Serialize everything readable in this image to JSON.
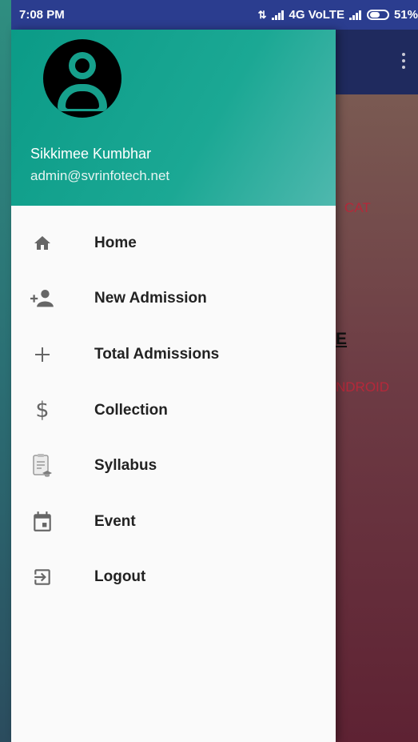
{
  "status_bar": {
    "time": "7:08 PM",
    "network": "4G VoLTE",
    "battery": "51%"
  },
  "background_app": {
    "text_cat": "CAT",
    "text_e": "E",
    "text_android": "NDROID"
  },
  "drawer": {
    "user_name": "Sikkimee Kumbhar",
    "user_email": "admin@svrinfotech.net",
    "menu_items": [
      {
        "label": "Home",
        "icon": "home-icon"
      },
      {
        "label": "New Admission",
        "icon": "add-person-icon"
      },
      {
        "label": "Total Admissions",
        "icon": "plus-icon"
      },
      {
        "label": "Collection",
        "icon": "dollar-icon"
      },
      {
        "label": "Syllabus",
        "icon": "syllabus-icon"
      },
      {
        "label": "Event",
        "icon": "calendar-icon"
      },
      {
        "label": "Logout",
        "icon": "logout-icon"
      }
    ]
  },
  "colors": {
    "header_gradient_start": "#0b9b87",
    "header_gradient_end": "#4fb8ae",
    "status_bar": "#2b3d8f",
    "drawer_bg": "#fafafa"
  }
}
